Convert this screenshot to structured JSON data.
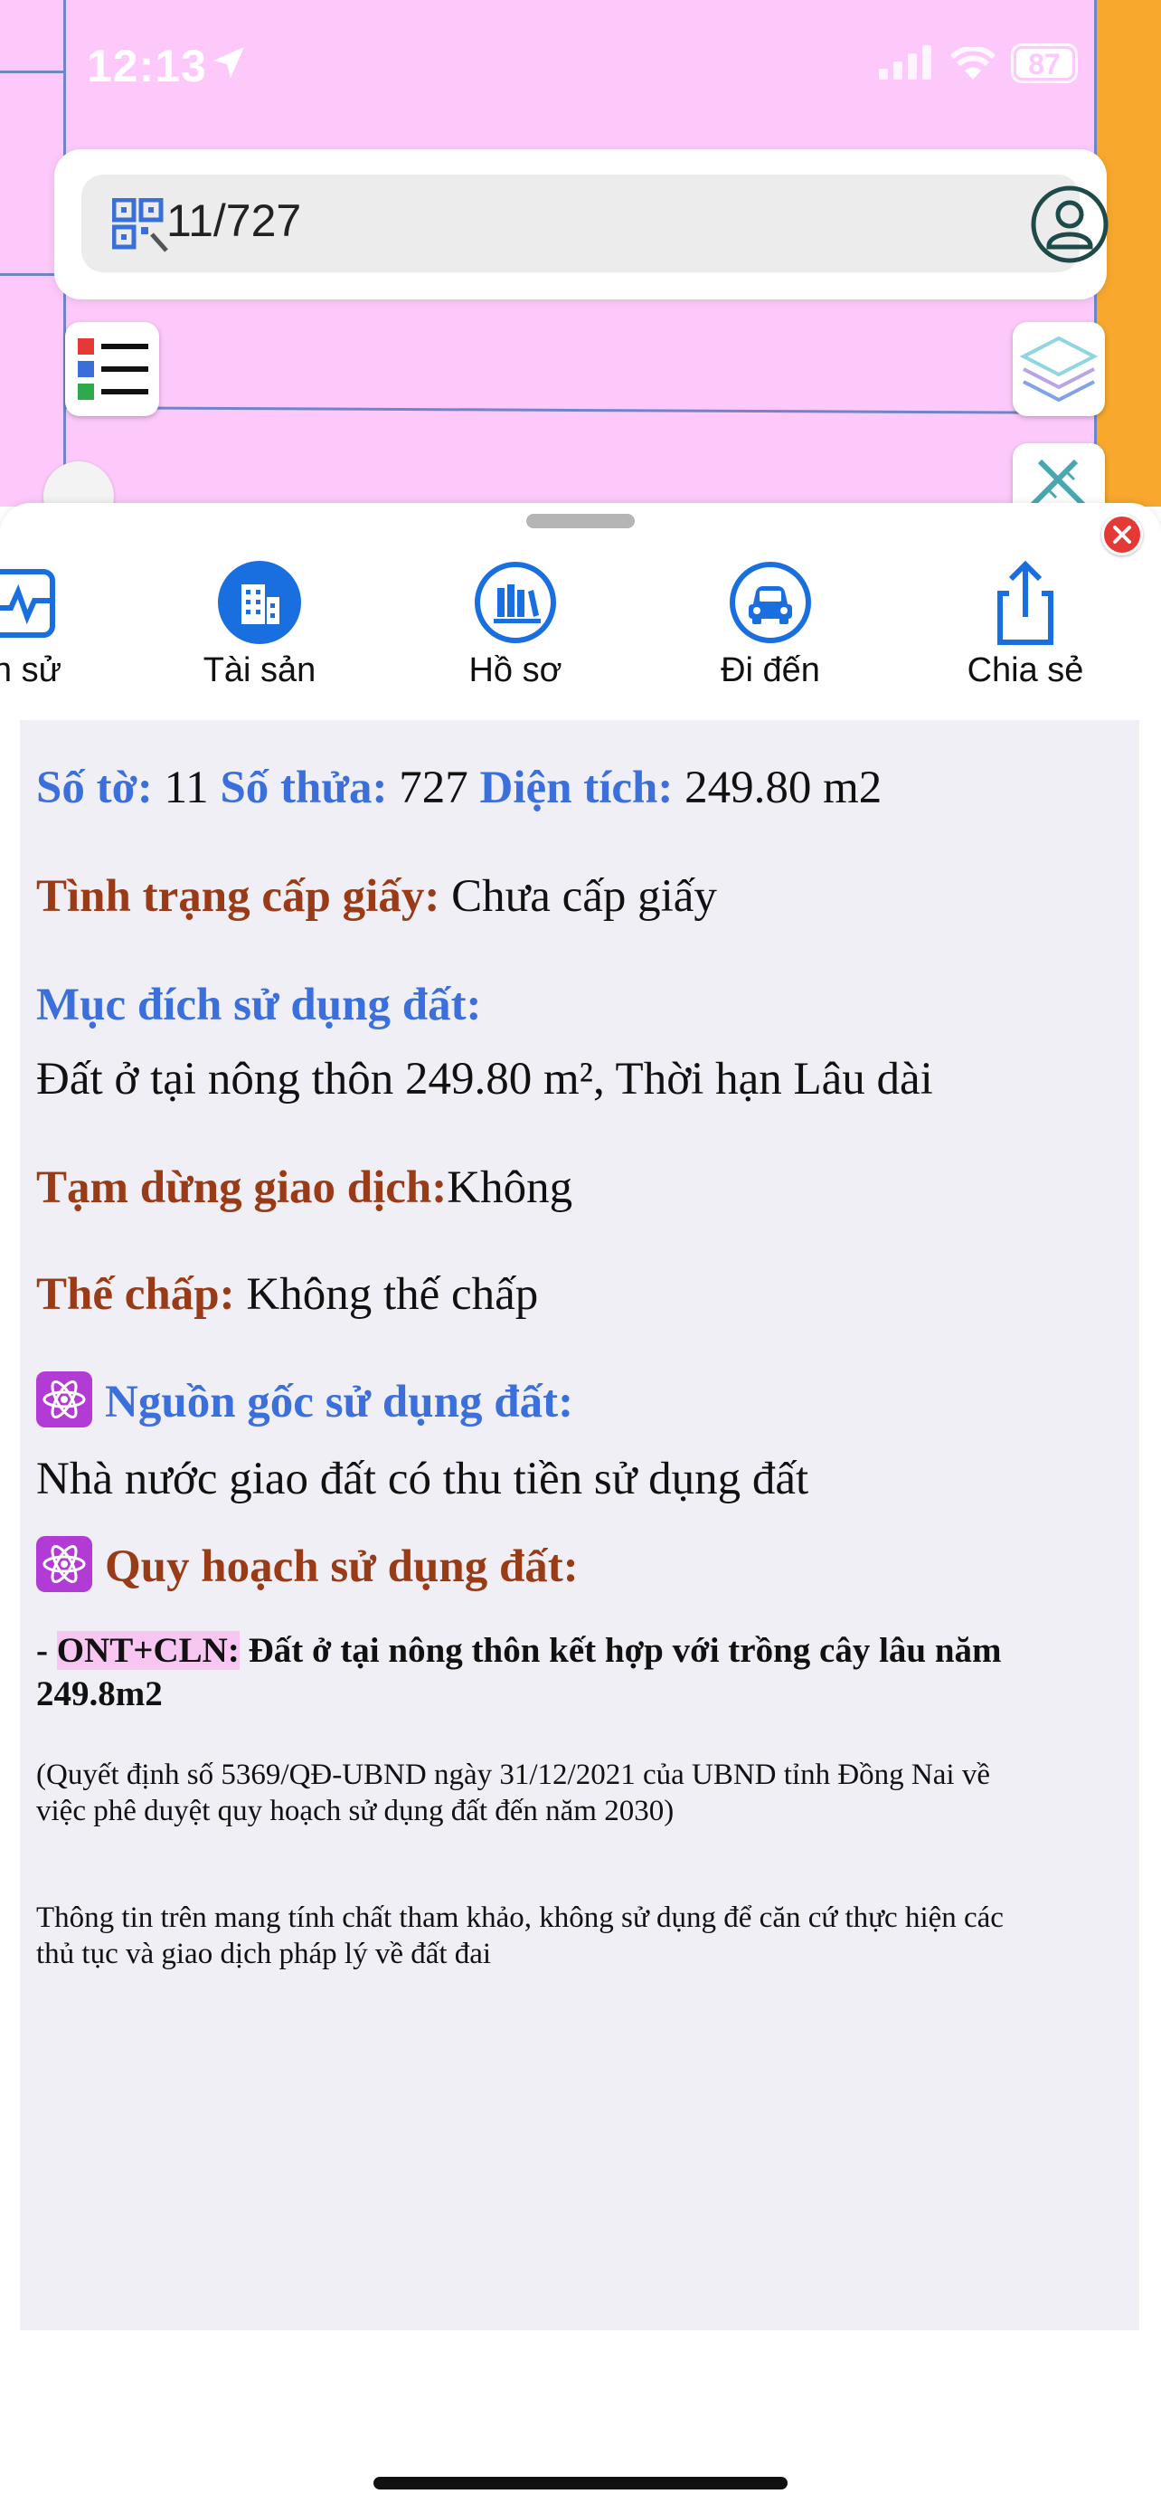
{
  "status_bar": {
    "time": "12:13",
    "battery": "87"
  },
  "search": {
    "value": "11/727"
  },
  "tabs": [
    {
      "label": "n sử",
      "icon": "history-chart-icon"
    },
    {
      "label": "Tài sản",
      "icon": "building-icon"
    },
    {
      "label": "Hồ sơ",
      "icon": "books-icon"
    },
    {
      "label": "Đi đến",
      "icon": "car-icon"
    },
    {
      "label": "Chia sẻ",
      "icon": "share-icon"
    }
  ],
  "info": {
    "so_to_label": "Số tờ:",
    "so_to_value": " 11 ",
    "so_thua_label": "Số thửa:",
    "so_thua_value": " 727 ",
    "dien_tich_label": "Diện tích:",
    "dien_tich_value": " 249.80 m2",
    "tinh_trang_label": "Tình trạng cấp giấy:",
    "tinh_trang_value": " Chưa cấp giấy",
    "muc_dich_label": "Mục đích sử dụng đất:",
    "muc_dich_value": "Đất ở tại nông thôn 249.80 m², Thời hạn Lâu dài",
    "tam_dung_label": "Tạm dừng giao dịch:",
    "tam_dung_value": "Không",
    "the_chap_label": "Thế chấp:",
    "the_chap_value": " Không thế chấp",
    "nguon_goc_label": "Nguồn gốc sử dụng đất:",
    "nguon_goc_value": "Nhà nước giao đất có thu tiền sử dụng đất",
    "quy_hoach_label": "Quy hoạch sử dụng đất:",
    "quy_hoach_prefix": "- ",
    "quy_hoach_code": "ONT+CLN:",
    "quy_hoach_desc_line1": " Đất ở tại nông thôn kết hợp với trồng cây lâu năm",
    "quy_hoach_desc_line2": "249.8m2",
    "decision_line1": "(Quyết định số 5369/QĐ-UBND ngày 31/12/2021 của UBND tỉnh Đồng Nai về",
    "decision_line2": "việc phê duyệt quy hoạch sử dụng đất đến năm 2030)",
    "disclaimer_line1": "Thông tin trên mang tính chất tham khảo, không sử dụng để căn cứ thực hiện các",
    "disclaimer_line2": "thủ tục và giao dịch pháp lý về đất đai"
  },
  "colors": {
    "map_bg": "#fdc9fa",
    "accent_blue": "#1a6fe0",
    "label_blue": "#3b6fdc",
    "label_red": "#9a3b17"
  }
}
